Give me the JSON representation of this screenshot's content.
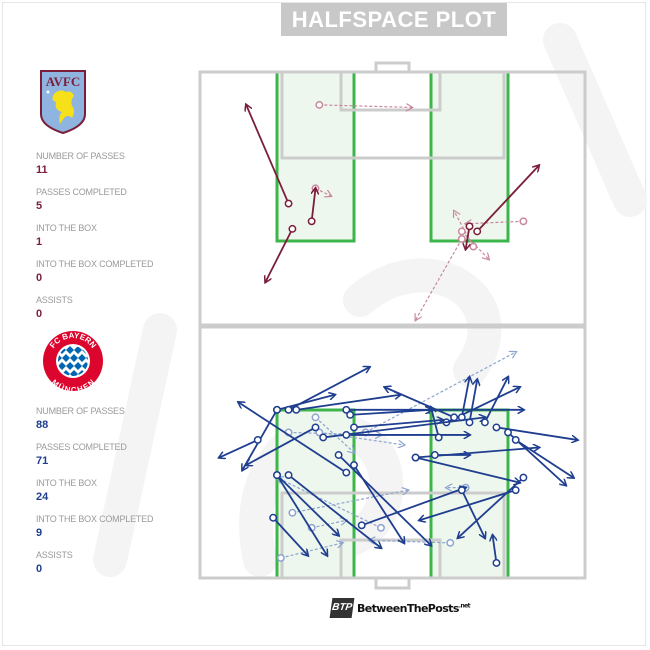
{
  "title": "HALFSPACE PLOT",
  "teams": [
    {
      "id": "villa",
      "badge_icon": "aston-villa-crest-icon",
      "badge_text": "AVFC",
      "color": "#7a1e3a",
      "stats": [
        {
          "label": "NUMBER OF PASSES",
          "value": "11"
        },
        {
          "label": "PASSES COMPLETED",
          "value": "5"
        },
        {
          "label": "INTO THE BOX",
          "value": "1"
        },
        {
          "label": "INTO THE BOX COMPLETED",
          "value": "0"
        },
        {
          "label": "ASSISTS",
          "value": "0"
        }
      ]
    },
    {
      "id": "bayern",
      "badge_icon": "bayern-munchen-crest-icon",
      "badge_text_top": "FC BAYERN",
      "badge_text_bottom": "MÜNCHEN",
      "color": "#1f3e8f",
      "stats": [
        {
          "label": "NUMBER OF PASSES",
          "value": "88"
        },
        {
          "label": "PASSES COMPLETED",
          "value": "71"
        },
        {
          "label": "INTO THE BOX",
          "value": "24"
        },
        {
          "label": "INTO THE BOX COMPLETED",
          "value": "9"
        },
        {
          "label": "ASSISTS",
          "value": "0"
        }
      ]
    }
  ],
  "footer": {
    "brand_badge": "BTP",
    "brand_name": "BetweenThePosts",
    "brand_suffix": ".net"
  },
  "colors": {
    "halfspace_line": "#3cb54a",
    "halfspace_fill": "#eef7ee",
    "pitch_line": "#cccccc",
    "villa": "#7a1e3a",
    "bayern": "#1f3e8f"
  },
  "chart_data": {
    "type": "scatter",
    "title": "HALFSPACE PLOT",
    "xlabel": "",
    "ylabel": "",
    "note": "Pass map; coordinates in pitch units, x 0-100 across width, y 0-100 from attacking goal line of each half (0 = goal line, 100 = halfway line). completed=true solid, false dashed/faded.",
    "series": [
      {
        "name": "Aston Villa",
        "passes": [
          {
            "x1": 31,
            "y1": 13,
            "x2": 55,
            "y2": 14,
            "completed": false
          },
          {
            "x1": 23,
            "y1": 52,
            "x2": 12,
            "y2": 13,
            "completed": true
          },
          {
            "x1": 29,
            "y1": 59,
            "x2": 30,
            "y2": 46,
            "completed": true
          },
          {
            "x1": 30,
            "y1": 46,
            "x2": 34,
            "y2": 49,
            "completed": false
          },
          {
            "x1": 24,
            "y1": 62,
            "x2": 17,
            "y2": 83,
            "completed": true
          },
          {
            "x1": 68,
            "y1": 66,
            "x2": 56,
            "y2": 98,
            "completed": false
          },
          {
            "x1": 84,
            "y1": 59,
            "x2": 69,
            "y2": 60,
            "completed": false
          },
          {
            "x1": 72,
            "y1": 63,
            "x2": 88,
            "y2": 37,
            "completed": true
          },
          {
            "x1": 70,
            "y1": 61,
            "x2": 69,
            "y2": 70,
            "completed": true
          },
          {
            "x1": 71,
            "y1": 69,
            "x2": 66,
            "y2": 55,
            "completed": false
          },
          {
            "x1": 68,
            "y1": 63,
            "x2": 75,
            "y2": 74,
            "completed": false
          }
        ]
      },
      {
        "name": "FC Bayern Munchen",
        "passes": [
          {
            "x1": 20,
            "y1": 67,
            "x2": 35,
            "y2": 73,
            "completed": true
          },
          {
            "x1": 23,
            "y1": 67,
            "x2": 44,
            "y2": 84,
            "completed": true
          },
          {
            "x1": 25,
            "y1": 67,
            "x2": 52,
            "y2": 73,
            "completed": true
          },
          {
            "x1": 38,
            "y1": 67,
            "x2": 84,
            "y2": 67,
            "completed": true
          },
          {
            "x1": 39,
            "y1": 65,
            "x2": 60,
            "y2": 67,
            "completed": true
          },
          {
            "x1": 64,
            "y1": 62,
            "x2": 83,
            "y2": 76,
            "completed": true
          },
          {
            "x1": 66,
            "y1": 64,
            "x2": 48,
            "y2": 76,
            "completed": true
          },
          {
            "x1": 68,
            "y1": 64,
            "x2": 70,
            "y2": 80,
            "completed": true
          },
          {
            "x1": 70,
            "y1": 62,
            "x2": 72,
            "y2": 79,
            "completed": true
          },
          {
            "x1": 74,
            "y1": 62,
            "x2": 80,
            "y2": 80,
            "completed": true
          },
          {
            "x1": 77,
            "y1": 60,
            "x2": 98,
            "y2": 55,
            "completed": true
          },
          {
            "x1": 80,
            "y1": 58,
            "x2": 95,
            "y2": 37,
            "completed": true
          },
          {
            "x1": 82,
            "y1": 55,
            "x2": 97,
            "y2": 40,
            "completed": true
          },
          {
            "x1": 20,
            "y1": 41,
            "x2": 36,
            "y2": 17,
            "completed": true
          },
          {
            "x1": 36,
            "y1": 49,
            "x2": 60,
            "y2": 13,
            "completed": true
          },
          {
            "x1": 20,
            "y1": 67,
            "x2": 11,
            "y2": 43,
            "completed": true
          },
          {
            "x1": 15,
            "y1": 55,
            "x2": 5,
            "y2": 48,
            "completed": true
          },
          {
            "x1": 40,
            "y1": 60,
            "x2": 63,
            "y2": 63,
            "completed": true
          },
          {
            "x1": 32,
            "y1": 56,
            "x2": 74,
            "y2": 64,
            "completed": true
          },
          {
            "x1": 38,
            "y1": 57,
            "x2": 70,
            "y2": 57,
            "completed": true
          },
          {
            "x1": 62,
            "y1": 56,
            "x2": 60,
            "y2": 68,
            "completed": true
          },
          {
            "x1": 20,
            "y1": 41,
            "x2": 33,
            "y2": 9,
            "completed": true
          },
          {
            "x1": 40,
            "y1": 45,
            "x2": 53,
            "y2": 14,
            "completed": true
          },
          {
            "x1": 84,
            "y1": 40,
            "x2": 67,
            "y2": 16,
            "completed": true
          },
          {
            "x1": 82,
            "y1": 35,
            "x2": 57,
            "y2": 23,
            "completed": true
          },
          {
            "x1": 56,
            "y1": 48,
            "x2": 88,
            "y2": 52,
            "completed": true
          },
          {
            "x1": 56,
            "y1": 48,
            "x2": 83,
            "y2": 38,
            "completed": true
          },
          {
            "x1": 38,
            "y1": 42,
            "x2": 10,
            "y2": 70,
            "completed": true
          },
          {
            "x1": 30,
            "y1": 60,
            "x2": 12,
            "y2": 45,
            "completed": true
          },
          {
            "x1": 23,
            "y1": 41,
            "x2": 47,
            "y2": 12,
            "completed": true
          },
          {
            "x1": 42,
            "y1": 21,
            "x2": 69,
            "y2": 36,
            "completed": true
          },
          {
            "x1": 19,
            "y1": 24,
            "x2": 28,
            "y2": 9,
            "completed": true
          },
          {
            "x1": 68,
            "y1": 35,
            "x2": 74,
            "y2": 16,
            "completed": true
          },
          {
            "x1": 61,
            "y1": 49,
            "x2": 70,
            "y2": 49,
            "completed": true
          },
          {
            "x1": 69,
            "y1": 36,
            "x2": 64,
            "y2": 36,
            "completed": false
          },
          {
            "x1": 23,
            "y1": 58,
            "x2": 47,
            "y2": 57,
            "completed": false
          },
          {
            "x1": 31,
            "y1": 58,
            "x2": 53,
            "y2": 53,
            "completed": false
          },
          {
            "x1": 30,
            "y1": 64,
            "x2": 40,
            "y2": 50,
            "completed": false
          },
          {
            "x1": 29,
            "y1": 20,
            "x2": 38,
            "y2": 23,
            "completed": false
          },
          {
            "x1": 24,
            "y1": 26,
            "x2": 54,
            "y2": 35,
            "completed": false
          },
          {
            "x1": 65,
            "y1": 14,
            "x2": 44,
            "y2": 15,
            "completed": false
          },
          {
            "x1": 21,
            "y1": 8,
            "x2": 37,
            "y2": 14,
            "completed": false
          },
          {
            "x1": 77,
            "y1": 6,
            "x2": 76,
            "y2": 17,
            "completed": true
          },
          {
            "x1": 47,
            "y1": 20,
            "x2": 20,
            "y2": 40,
            "completed": false
          },
          {
            "x1": 43,
            "y1": 58,
            "x2": 82,
            "y2": 90,
            "completed": false
          }
        ]
      }
    ],
    "legend": "none"
  }
}
